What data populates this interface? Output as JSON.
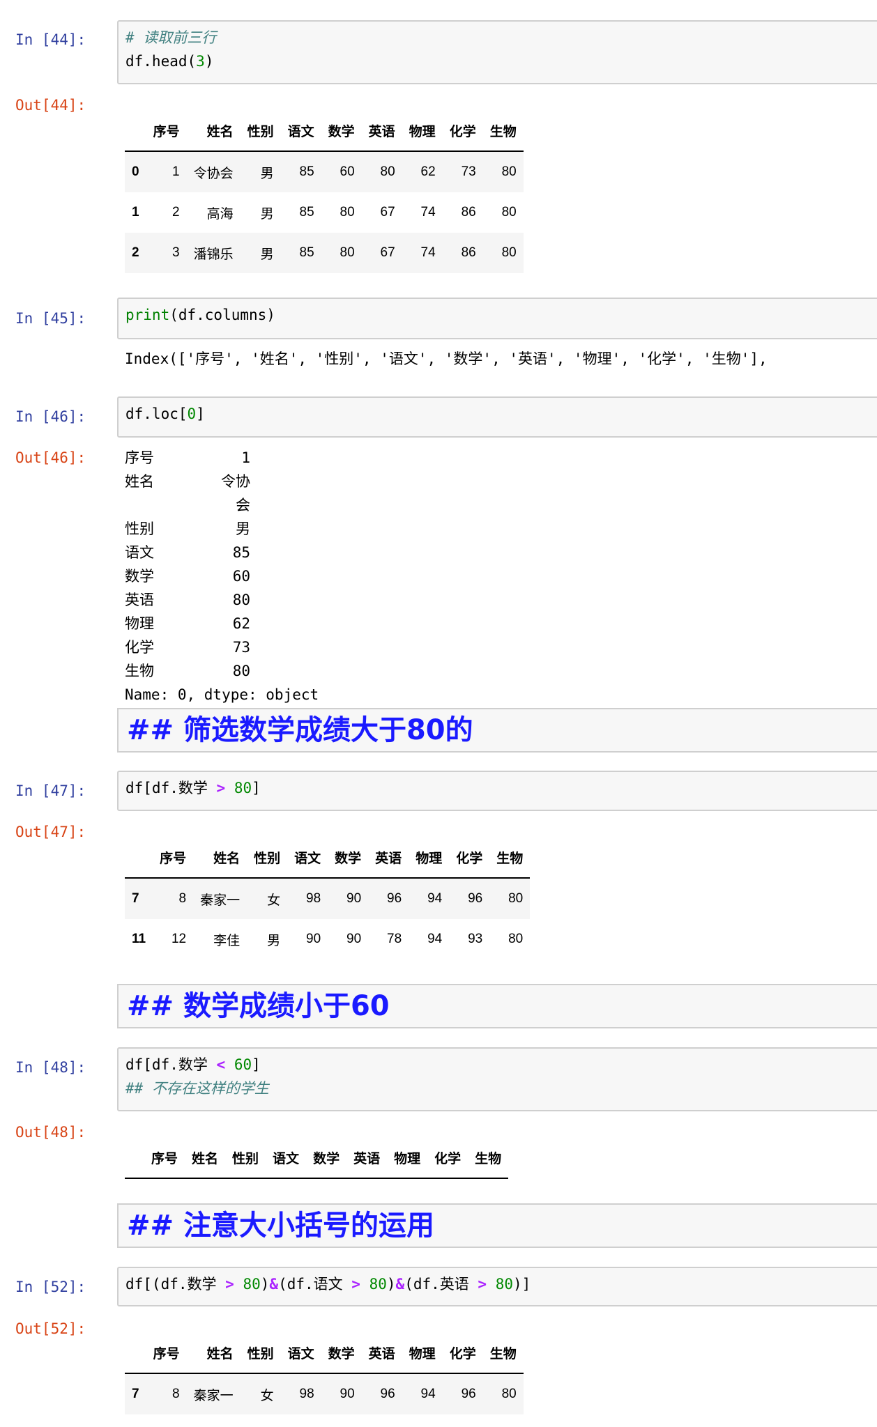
{
  "columns": [
    "序号",
    "姓名",
    "性别",
    "语文",
    "数学",
    "英语",
    "物理",
    "化学",
    "生物"
  ],
  "cells": {
    "c44": {
      "prompt_in": "In [44]:",
      "prompt_out": "Out[44]:",
      "comment": "# 读取前三行",
      "code_a": "df.head(",
      "code_num": "3",
      "code_b": ")",
      "rows": [
        [
          "0",
          "1",
          "令协会",
          "男",
          "85",
          "60",
          "80",
          "62",
          "73",
          "80"
        ],
        [
          "1",
          "2",
          "高海",
          "男",
          "85",
          "80",
          "67",
          "74",
          "86",
          "80"
        ],
        [
          "2",
          "3",
          "潘锦乐",
          "男",
          "85",
          "80",
          "67",
          "74",
          "86",
          "80"
        ]
      ]
    },
    "c45": {
      "prompt_in": "In [45]:",
      "code_kw": "print",
      "code_rest": "(df.columns)",
      "output": "Index(['序号', '姓名', '性别', '语文', '数学', '英语', '物理', '化学', '生物'],"
    },
    "c46": {
      "prompt_in": "In [46]:",
      "prompt_out": "Out[46]:",
      "code_a": "df.loc[",
      "code_num": "0",
      "code_b": "]",
      "series": [
        [
          "序号",
          "1"
        ],
        [
          "姓名",
          "令协会"
        ],
        [
          "性别",
          "男"
        ],
        [
          "语文",
          "85"
        ],
        [
          "数学",
          "60"
        ],
        [
          "英语",
          "80"
        ],
        [
          "物理",
          "62"
        ],
        [
          "化学",
          "73"
        ],
        [
          "生物",
          "80"
        ]
      ],
      "footer": "Name: 0, dtype: object"
    },
    "md1": "## 筛选数学成绩大于80的",
    "c47": {
      "prompt_in": "In [47]:",
      "prompt_out": "Out[47]:",
      "code_a": "df[df.数学 ",
      "op": ">",
      "code_num": " 80",
      "code_b": "]",
      "rows": [
        [
          "7",
          "8",
          "秦家一",
          "女",
          "98",
          "90",
          "96",
          "94",
          "96",
          "80"
        ],
        [
          "11",
          "12",
          "李佳",
          "男",
          "90",
          "90",
          "78",
          "94",
          "93",
          "80"
        ]
      ]
    },
    "md2": "## 数学成绩小于60",
    "c48": {
      "prompt_in": "In [48]:",
      "prompt_out": "Out[48]:",
      "code_a": "df[df.数学 ",
      "op": "<",
      "code_num": " 60",
      "code_b": "]",
      "comment": "## 不存在这样的学生",
      "rows": []
    },
    "md3": "## 注意大小括号的运用",
    "c52": {
      "prompt_in": "In [52]:",
      "prompt_out": "Out[52]:",
      "code_p1": "df[(df.数学 ",
      "op1": ">",
      "n1": " 80",
      "p2": ")",
      "amp1": "&",
      "p3": "(df.语文 ",
      "op2": ">",
      "n2": " 80",
      "p4": ")",
      "amp2": "&",
      "p5": "(df.英语 ",
      "op3": ">",
      "n3": " 80",
      "p6": ")]",
      "rows": [
        [
          "7",
          "8",
          "秦家一",
          "女",
          "98",
          "90",
          "96",
          "94",
          "96",
          "80"
        ]
      ]
    }
  }
}
